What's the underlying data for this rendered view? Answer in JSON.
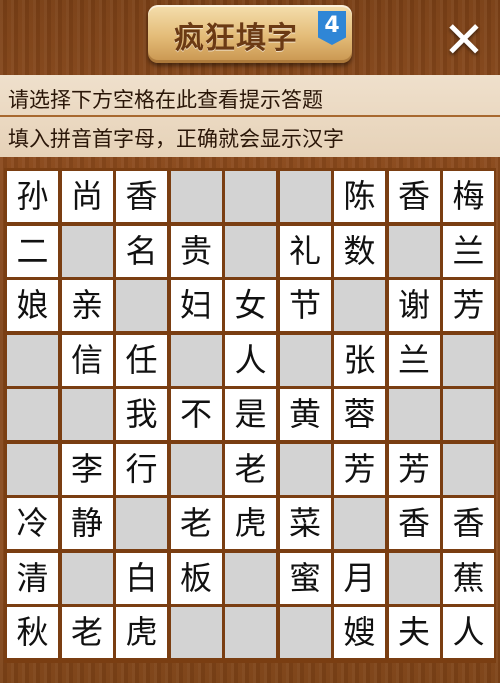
{
  "header": {
    "title": "疯狂填字",
    "level": "4",
    "close_symbol": "✕"
  },
  "hints": {
    "line1": "请选择下方空格在此查看提示答题",
    "line2": "填入拼音首字母，正确就会显示汉字"
  },
  "grid": [
    [
      "孙",
      "尚",
      "香",
      "",
      "",
      "",
      "陈",
      "香",
      "梅"
    ],
    [
      "二",
      "",
      "名",
      "贵",
      "",
      "礼",
      "数",
      "",
      "兰"
    ],
    [
      "娘",
      "亲",
      "",
      "妇",
      "女",
      "节",
      "",
      "谢",
      "芳"
    ],
    [
      "",
      "信",
      "任",
      "",
      "人",
      "",
      "张",
      "兰",
      ""
    ],
    [
      "",
      "",
      "我",
      "不",
      "是",
      "黄",
      "蓉",
      "",
      ""
    ],
    [
      "",
      "李",
      "行",
      "",
      "老",
      "",
      "芳",
      "芳",
      ""
    ],
    [
      "冷",
      "静",
      "",
      "老",
      "虎",
      "菜",
      "",
      "香",
      "香"
    ],
    [
      "清",
      "",
      "白",
      "板",
      "",
      "蜜",
      "月",
      "",
      "蕉"
    ],
    [
      "秋",
      "老",
      "虎",
      "",
      "",
      "",
      "嫂",
      "夫",
      "人"
    ]
  ],
  "colors": {
    "board_border": "#7a3e12",
    "filled_cell": "#ffffff",
    "empty_cell": "#d3d3d3",
    "wood_background": "#8b4a1c",
    "hint_panel": "#efe0cc",
    "level_badge": "#2f86d6"
  }
}
